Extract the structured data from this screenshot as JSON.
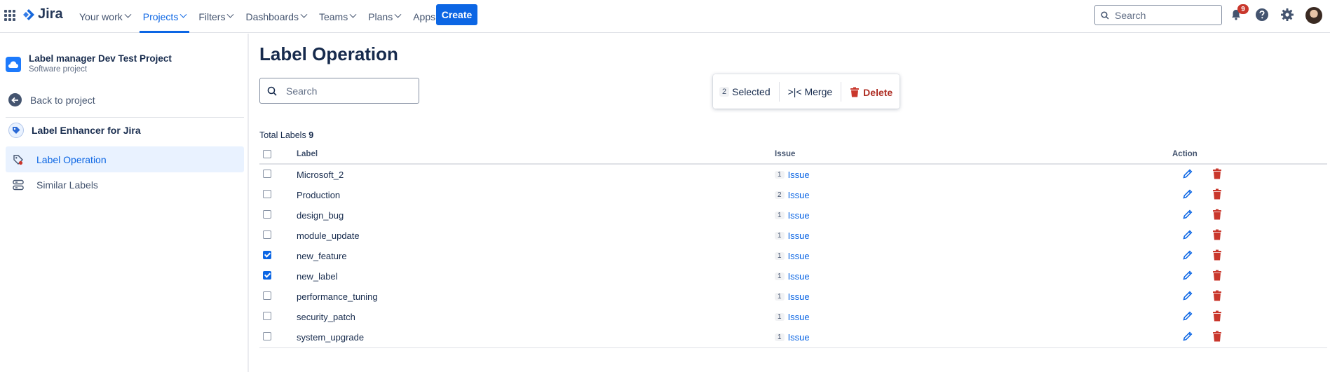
{
  "topnav": {
    "logo_text": "Jira",
    "items": [
      {
        "label": "Your work"
      },
      {
        "label": "Projects"
      },
      {
        "label": "Filters"
      },
      {
        "label": "Dashboards"
      },
      {
        "label": "Teams"
      },
      {
        "label": "Plans"
      },
      {
        "label": "Apps"
      }
    ],
    "active_item": "Projects",
    "create_label": "Create",
    "search_placeholder": "Search",
    "notification_count": "9",
    "accent": "#0c66e4"
  },
  "sidebar": {
    "project_name": "Label manager Dev Test Project",
    "project_type": "Software project",
    "back_label": "Back to project",
    "addon_label": "Label Enhancer for Jira",
    "items": [
      {
        "label": "Label Operation",
        "icon": "label-icon"
      },
      {
        "label": "Similar Labels",
        "icon": "stack-icon"
      }
    ]
  },
  "main": {
    "title": "Label Operation",
    "search_placeholder": "Search",
    "bulk": {
      "count": "2",
      "selected_label": "Selected",
      "merge_label": ">|< Merge",
      "delete_label": "Delete"
    },
    "total_label": "Total Labels",
    "total_count": "9",
    "columns": {
      "label": "Label",
      "issue": "Issue",
      "action": "Action"
    },
    "rows": [
      {
        "label": "Microsoft_2",
        "count": "1",
        "issue": "Issue",
        "checked": false
      },
      {
        "label": "Production",
        "count": "2",
        "issue": "Issue",
        "checked": false
      },
      {
        "label": "design_bug",
        "count": "1",
        "issue": "Issue",
        "checked": false
      },
      {
        "label": "module_update",
        "count": "1",
        "issue": "Issue",
        "checked": false
      },
      {
        "label": "new_feature",
        "count": "1",
        "issue": "Issue",
        "checked": true
      },
      {
        "label": "new_label",
        "count": "1",
        "issue": "Issue",
        "checked": true
      },
      {
        "label": "performance_tuning",
        "count": "1",
        "issue": "Issue",
        "checked": false
      },
      {
        "label": "security_patch",
        "count": "1",
        "issue": "Issue",
        "checked": false
      },
      {
        "label": "system_upgrade",
        "count": "1",
        "issue": "Issue",
        "checked": false
      }
    ],
    "delete_color": "#c9372c"
  }
}
